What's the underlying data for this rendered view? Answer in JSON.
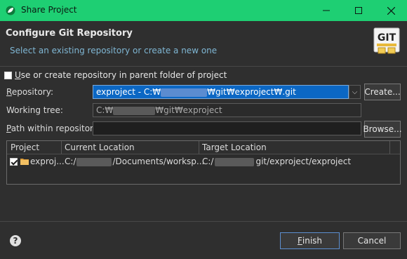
{
  "window": {
    "title": "Share Project",
    "controls": {
      "minimize": "—",
      "maximize": "☐",
      "close": "✕"
    }
  },
  "header": {
    "title": "Configure Git Repository",
    "subtitle": "Select an existing repository or create a new one",
    "logo_text": "GIT"
  },
  "use_parent_checkbox": {
    "label": "Use or create repository in parent folder of project",
    "checked": false
  },
  "repository": {
    "label": "Repository:",
    "value_prefix": "exproject - C:₩",
    "value_suffix": "₩git₩exproject₩.git",
    "create_button": "Create..."
  },
  "working_tree": {
    "label": "Working tree:",
    "value_prefix": "C:₩",
    "value_suffix": "₩git₩exproject"
  },
  "path_within_repo": {
    "label": "Path within repository:",
    "value": "",
    "browse_button": "Browse..."
  },
  "table": {
    "columns": [
      "Project",
      "Current Location",
      "Target Location"
    ],
    "rows": [
      {
        "checked": true,
        "project": "exproj...",
        "current_prefix": "C:/",
        "current_suffix": "/Documents/worksp...",
        "target_prefix": "C:/",
        "target_suffix": "git/exproject/exproject"
      }
    ]
  },
  "footer": {
    "help_icon": "?",
    "finish_button": "Finish",
    "cancel_button": "Cancel"
  },
  "colors": {
    "titlebar": "#1ecf73",
    "background": "#2f2f2f",
    "selection": "#0b67c4",
    "subtitle": "#7fb6d3"
  }
}
